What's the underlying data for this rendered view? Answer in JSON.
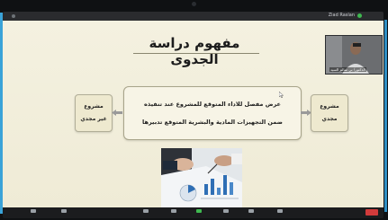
{
  "window": {
    "share_indicator": "Ziad Raslan"
  },
  "slide": {
    "title": "مفهوم دراسة الجدوى",
    "main_box": {
      "line1": "عرض مفصل للاداء المتوقع للمشروع عند تنفيذه",
      "line2": "ضمن التجهيزات المادية والبشرية المتوقع تدبيرها"
    },
    "left_box": {
      "line1": "مشروع",
      "line2": "غير مجدي"
    },
    "right_box": {
      "line1": "مشروع",
      "line2": "مجدي"
    },
    "image_alt": "business-charts-photo"
  },
  "webcam": {
    "name": "الدكتور/ بي سالم السيد"
  },
  "toolbar": {
    "items": [
      "",
      "",
      "",
      "",
      "",
      "",
      "",
      ""
    ],
    "end_label": ""
  },
  "colors": {
    "slide_bg": "#f4f1e0",
    "box_border": "#a8a48a",
    "bezel_glow": "#3aa3d8",
    "arrow": "#9a9a9a"
  }
}
